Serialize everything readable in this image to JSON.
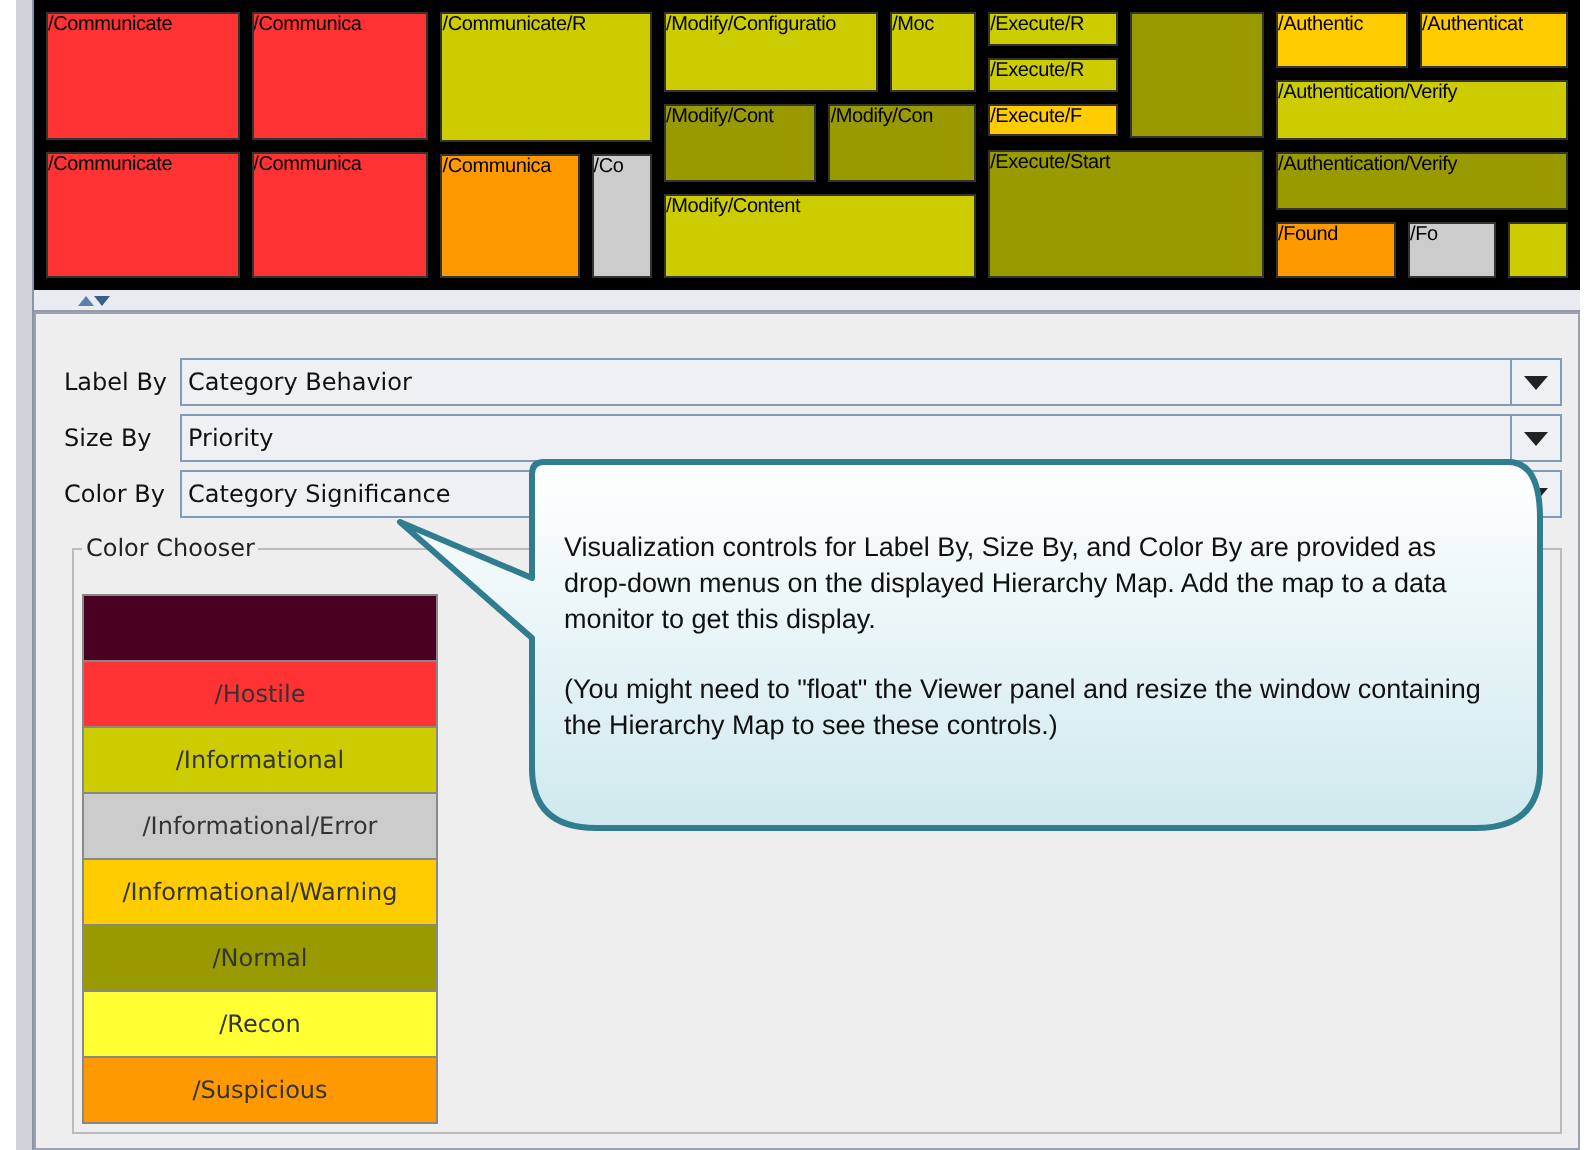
{
  "treemap": {
    "children": [
      {
        "children": [
          {
            "children": [
              {
                "label": "/Communicate",
                "color": "#ff3333"
              },
              {
                "label": "/Communica",
                "color": "#ff3333"
              }
            ]
          },
          {
            "children": [
              {
                "label": "/Communicate",
                "color": "#ff3333"
              },
              {
                "label": "/Communica",
                "color": "#ff3333"
              }
            ]
          }
        ]
      },
      {
        "children": [
          {
            "label": "/Communicate/R",
            "color": "#cccc00"
          },
          {
            "children": [
              {
                "label": "/Communica",
                "color": "#ff9900"
              },
              {
                "label": "/Co",
                "color": "#cccccc"
              }
            ]
          }
        ]
      },
      {
        "children": [
          {
            "children": [
              {
                "label": "/Modify/Configuratio",
                "color": "#cccc00"
              },
              {
                "label": "/Moc",
                "color": "#cccc00"
              }
            ]
          },
          {
            "children": [
              {
                "label": "/Modify/Cont",
                "color": "#999900"
              },
              {
                "label": "/Modify/Con",
                "color": "#999900"
              }
            ]
          },
          {
            "label": "/Modify/Content",
            "color": "#cccc00"
          }
        ]
      },
      {
        "children": [
          {
            "children": [
              {
                "children": [
                  {
                    "label": "/Execute/R",
                    "color": "#cccc00"
                  },
                  {
                    "label": "/Execute/R",
                    "color": "#cccc00"
                  },
                  {
                    "label": "/Execute/F",
                    "color": "#ffcc00"
                  }
                ]
              },
              {
                "color": "#999900"
              }
            ]
          },
          {
            "label": "/Execute/Start",
            "color": "#999900"
          }
        ]
      },
      {
        "children": [
          {
            "children": [
              {
                "label": "/Authentic",
                "color": "#ffcc00"
              },
              {
                "label": "/Authenticat",
                "color": "#ffcc00"
              }
            ]
          },
          {
            "label": "/Authentication/Verify",
            "color": "#cccc00"
          },
          {
            "label": "/Authentication/Verify",
            "color": "#999900"
          },
          {
            "children": [
              {
                "label": "/Found",
                "color": "#ff9900"
              },
              {
                "label": "/Fo",
                "color": "#cccccc"
              },
              {
                "color": "#cccc00"
              }
            ]
          }
        ]
      }
    ]
  },
  "controls": [
    {
      "label": "Label By",
      "value": "Category Behavior"
    },
    {
      "label": "Size By",
      "value": "Priority"
    },
    {
      "label": "Color By",
      "value": "Category Significance"
    }
  ],
  "color_chooser": {
    "title": "Color Chooser",
    "swatches": [
      {
        "color": "#4a0020"
      },
      {
        "label": "/Hostile",
        "color": "#ff3333"
      },
      {
        "label": "/Informational",
        "color": "#cccc00"
      },
      {
        "label": "/Informational/Error",
        "color": "#cccccc"
      },
      {
        "label": "/Informational/Warning",
        "color": "#ffcc00"
      },
      {
        "label": "/Normal",
        "color": "#999900"
      },
      {
        "label": "/Recon",
        "color": "#ffff33"
      },
      {
        "label": "/Suspicious",
        "color": "#ff9900"
      }
    ]
  },
  "callout": {
    "paragraphs": [
      "Visualization controls for Label By, Size By, and Color By are provided as drop-down menus on the displayed Hierarchy Map. Add the map to a data monitor to get this display.",
      "(You might need to \"float\" the Viewer panel and resize the window containing the Hierarchy Map to see these controls.)"
    ]
  }
}
